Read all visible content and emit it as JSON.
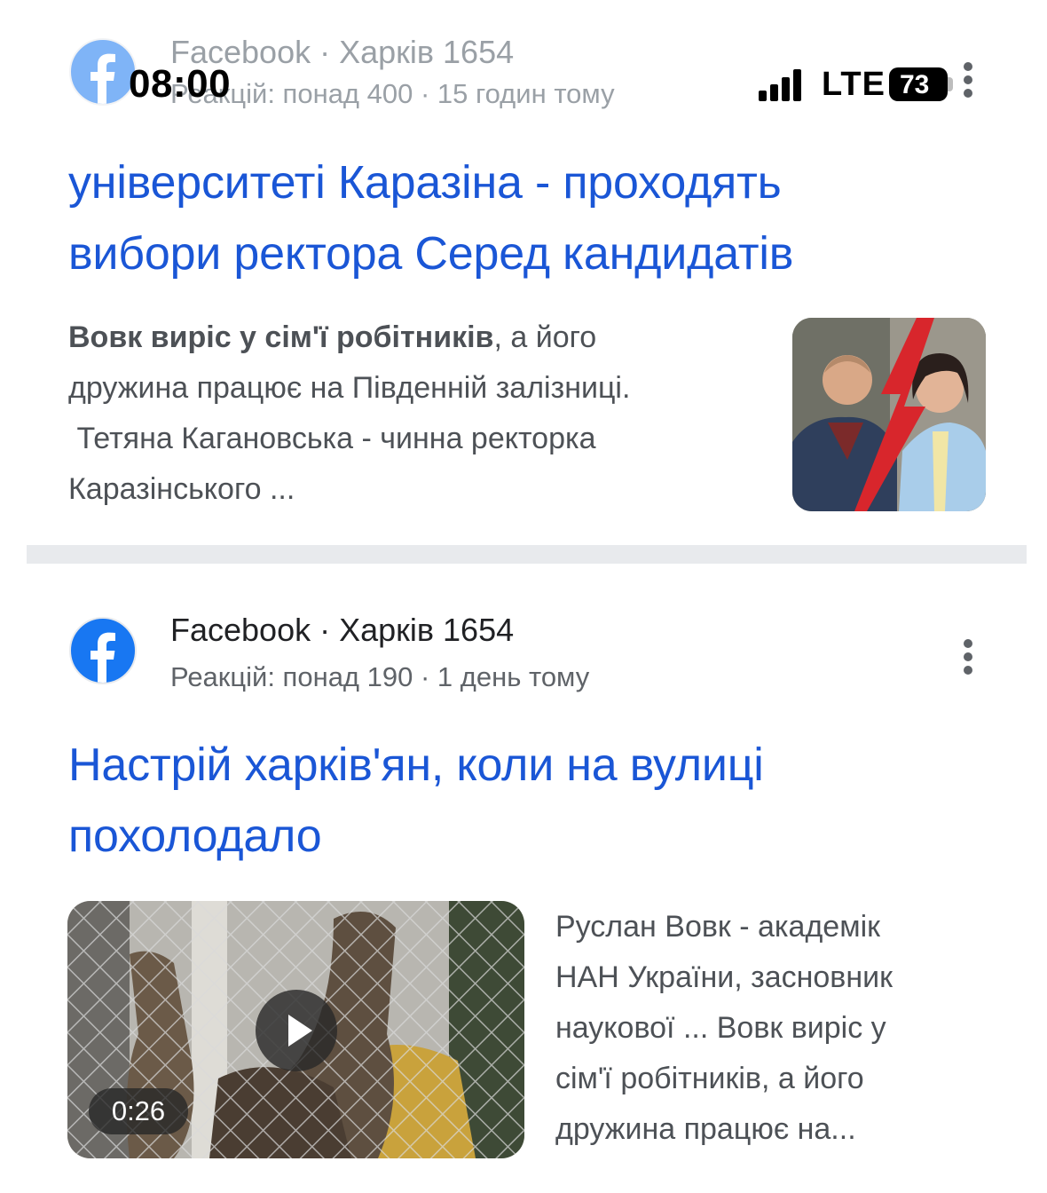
{
  "status_bar": {
    "time": "08:00",
    "network": "LTE",
    "battery": "73"
  },
  "results": [
    {
      "source": "Facebook · Харків 1654",
      "meta": "Реакцій: понад 400 · 15 годин тому",
      "title_lines": [
        "університеті Каразіна - проходять",
        "вибори ректора Серед кандидатів"
      ],
      "snippet_bold": "Вовк виріс у сім'ї робітників",
      "snippet_lines": [
        ", а його",
        "дружина працює на Південній залізниці.",
        " Тетяна Кагановська - чинна ректорка",
        "Каразінського ..."
      ]
    },
    {
      "source": "Facebook · Харків 1654",
      "meta": "Реакцій: понад 190 · 1 день тому",
      "title_lines": [
        "Настрій харків'ян, коли на вулиці",
        "похолодало"
      ],
      "video_duration": "0:26",
      "snippet_lines": [
        "Руслан Вовк - академік",
        "НАН України, засновник",
        "наукової ... Вовк виріс у",
        "сім'ї робітників, а його",
        "дружина працює на..."
      ]
    }
  ],
  "colors": {
    "link": "#1a56d6",
    "facebook": "#1877f2"
  },
  "icons": [
    "facebook-logo-icon",
    "more-vert-icon",
    "signal-icon",
    "battery-icon",
    "play-icon"
  ]
}
